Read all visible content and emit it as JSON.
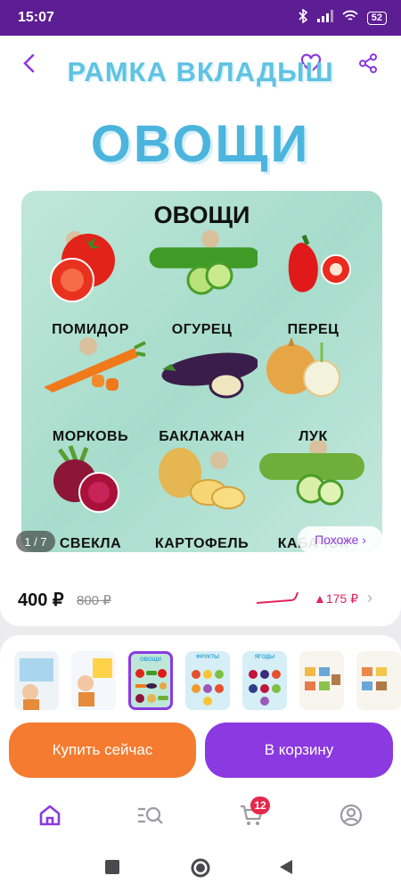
{
  "status": {
    "time": "15:07",
    "battery": "52"
  },
  "header": {
    "title": "РАМКА ВКЛАДЫШ",
    "subtitle": "ОВОЩИ"
  },
  "poster": {
    "title": "ОВОЩИ",
    "items": [
      {
        "label": "ПОМИДОР",
        "icon": "tomato-icon"
      },
      {
        "label": "ОГУРЕЦ",
        "icon": "cucumber-icon"
      },
      {
        "label": "ПЕРЕЦ",
        "icon": "pepper-icon"
      },
      {
        "label": "МОРКОВЬ",
        "icon": "carrot-icon"
      },
      {
        "label": "БАКЛАЖАН",
        "icon": "eggplant-icon"
      },
      {
        "label": "ЛУК",
        "icon": "onion-icon"
      },
      {
        "label": "СВЕКЛА",
        "icon": "beet-icon"
      },
      {
        "label": "КАРТОФЕЛЬ",
        "icon": "potato-icon"
      },
      {
        "label": "КАБАЧОК",
        "icon": "zucchini-icon"
      }
    ],
    "counter": "1 / 7",
    "similar_label": "Похоже ›"
  },
  "price": {
    "current": "400 ₽",
    "old": "800 ₽",
    "delta": "▲175 ₽"
  },
  "thumbnails": {
    "selected_index": 2,
    "captions": [
      "",
      "",
      "ОВОЩИ",
      "ФРУКТЫ",
      "ЯГОДЫ",
      "",
      ""
    ]
  },
  "actions": {
    "buy_now": "Купить сейчас",
    "add_to_cart": "В корзину"
  },
  "tabbar": {
    "cart_badge": "12"
  },
  "colors": {
    "accent": "#8a3ae0",
    "buy": "#f47b30",
    "statusbar": "#5d1d93"
  }
}
